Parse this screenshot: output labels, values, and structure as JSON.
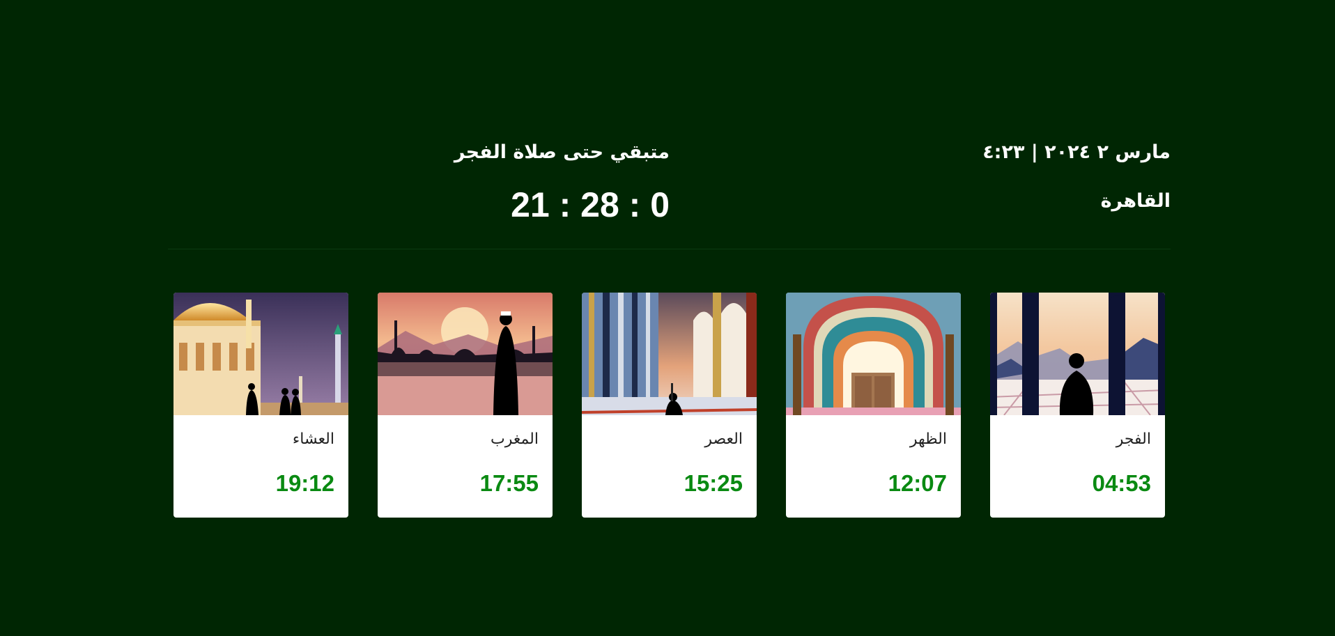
{
  "header": {
    "datetime": "مارس ٢ ٢٠٢٤ | ٤:٢٣",
    "city": "القاهرة",
    "next_prayer_label": "متبقي حتى صلاة الفجر",
    "countdown": "21 : 28 : 0"
  },
  "prayers": [
    {
      "name": "الفجر",
      "time": "04:53",
      "image_icon": "seated-worshipper-dawn"
    },
    {
      "name": "الظهر",
      "time": "12:07",
      "image_icon": "mosque-arch-interior"
    },
    {
      "name": "العصر",
      "time": "15:25",
      "image_icon": "mosque-colonnade"
    },
    {
      "name": "المغرب",
      "time": "17:55",
      "image_icon": "sunset-mosque-silhouette"
    },
    {
      "name": "العشاء",
      "time": "19:12",
      "image_icon": "mosque-night"
    }
  ],
  "colors": {
    "background": "#002603",
    "time_green": "#0a8a12",
    "card_bg": "#ffffff"
  }
}
